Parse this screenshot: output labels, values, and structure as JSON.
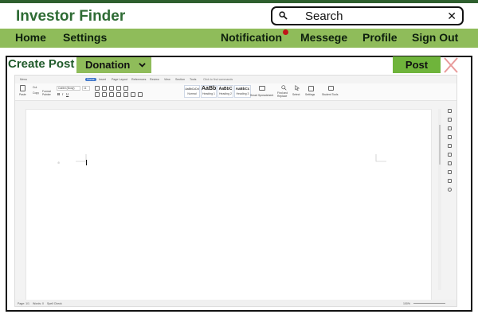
{
  "header": {
    "app_title": "Investor Finder",
    "search": {
      "placeholder": "Search",
      "clear_glyph": "✕",
      "icon": "search-icon"
    }
  },
  "nav": {
    "left": [
      {
        "label": "Home"
      },
      {
        "label": "Settings"
      }
    ],
    "right": [
      {
        "label": "Notification"
      },
      {
        "label": "Messege"
      },
      {
        "label": "Profile"
      },
      {
        "label": "Sign Out"
      }
    ],
    "notification_dot_color": "#c0151a"
  },
  "create_post": {
    "title": "Create Post",
    "category": {
      "selected": "Donation"
    },
    "post_label": "Post",
    "close_icon": "close-icon"
  },
  "editor": {
    "tabs": [
      "Menu",
      "Home",
      "Insert",
      "Page Layout",
      "References",
      "Review",
      "View",
      "Section",
      "Tools"
    ],
    "active_tab": "Home",
    "command_search": "Click to find commands",
    "ribbon": {
      "paste": "Paste",
      "cut": "Cut",
      "copy": "Copy",
      "format_painter": "Format Painter",
      "font": "Calibri (Body)",
      "font_size": "11",
      "styles": [
        {
          "sample": "AaBbCcDd",
          "name": "Normal"
        },
        {
          "sample": "AaBb",
          "name": "Heading 1"
        },
        {
          "sample": "AaBbC",
          "name": "Heading 2"
        },
        {
          "sample": "AaBbCc",
          "name": "Heading 3"
        }
      ],
      "smart_spellcheck": "Smart Spreadsheet",
      "find_replace": "Find and Replace",
      "select": "Select",
      "settings": "Settings",
      "student_tools": "Student Tools"
    },
    "status": {
      "page": "Page: 1/1",
      "words": "Words: 0",
      "spell": "Spell Check",
      "zoom": "100%"
    }
  }
}
